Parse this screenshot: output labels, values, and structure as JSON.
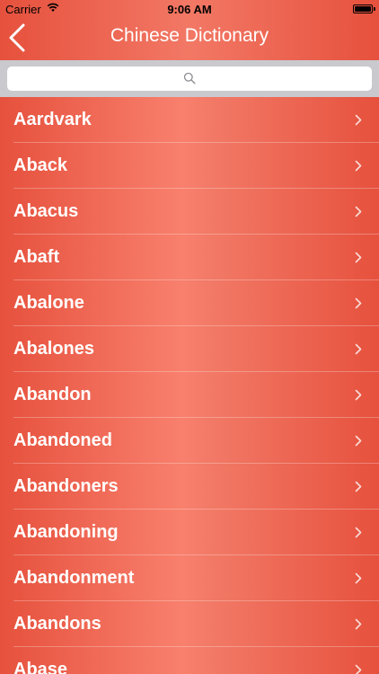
{
  "status_bar": {
    "carrier": "Carrier",
    "time": "9:06 AM"
  },
  "navbar": {
    "title": "Chinese Dictionary",
    "back_icon": "chevron-left-icon"
  },
  "search": {
    "placeholder": "",
    "icon": "search-icon"
  },
  "colors": {
    "accent": "#ea5a44",
    "accent_light": "#f8806d",
    "search_bar_bg": "#c9c9ce"
  },
  "words": [
    "Aardvark",
    "Aback",
    "Abacus",
    "Abaft",
    "Abalone",
    "Abalones",
    "Abandon",
    "Abandoned",
    "Abandoners",
    "Abandoning",
    "Abandonment",
    "Abandons",
    "Abase"
  ]
}
